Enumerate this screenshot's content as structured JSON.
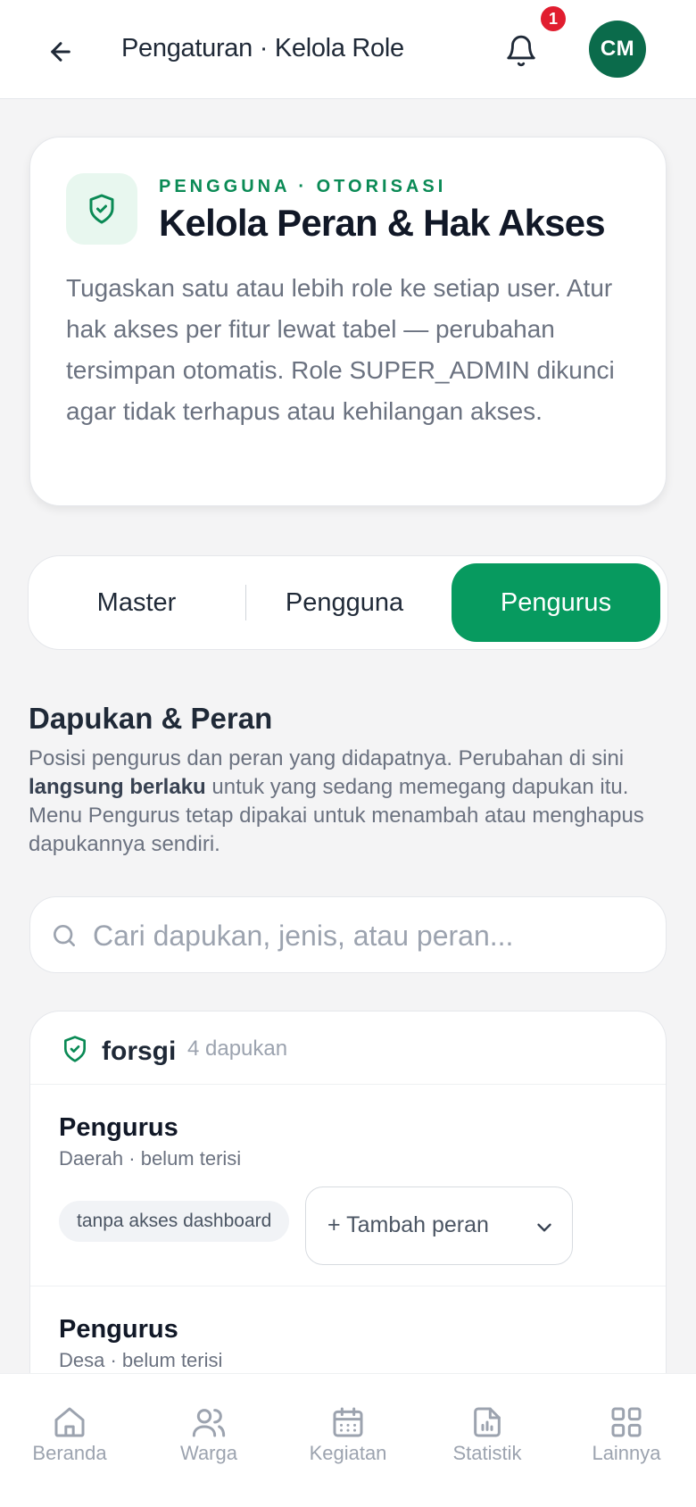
{
  "header": {
    "title": "Pengaturan · Kelola Role",
    "notification_count": "1",
    "avatar_initials": "CM"
  },
  "intro": {
    "eyebrow": "PENGGUNA · OTORISASI",
    "title": "Kelola Peran & Hak Akses",
    "description": "Tugaskan satu atau lebih role ke setiap user. Atur hak akses per fitur lewat tabel — perubahan tersimpan otomatis. Role SUPER_ADMIN dikunci agar tidak terhapus atau kehilangan akses."
  },
  "tabs": [
    {
      "label": "Master",
      "active": false
    },
    {
      "label": "Pengguna",
      "active": false
    },
    {
      "label": "Pengurus",
      "active": true
    }
  ],
  "section": {
    "title": "Dapukan & Peran",
    "desc_part1": "Posisi pengurus dan peran yang didapatnya. Perubahan di sini ",
    "desc_bold": "langsung berlaku",
    "desc_part2": " untuk yang sedang memegang dapukan itu. Menu Pengurus tetap dipakai untuk menambah atau menghapus dapukannya sendiri."
  },
  "search": {
    "placeholder": "Cari dapukan, jenis, atau peran...",
    "value": ""
  },
  "group": {
    "name": "forsgi",
    "count": "4 dapukan",
    "rows": [
      {
        "title": "Pengurus",
        "subtitle": "Daerah · belum terisi",
        "chip": "tanpa akses dashboard",
        "add_label": "+ Tambah peran"
      },
      {
        "title": "Pengurus",
        "subtitle": "Desa · belum terisi"
      }
    ]
  },
  "bottom_nav": [
    {
      "label": "Beranda",
      "icon": "home-icon"
    },
    {
      "label": "Warga",
      "icon": "users-icon"
    },
    {
      "label": "Kegiatan",
      "icon": "calendar-icon"
    },
    {
      "label": "Statistik",
      "icon": "chart-icon"
    },
    {
      "label": "Lainnya",
      "icon": "grid-icon"
    }
  ],
  "colors": {
    "primary": "#079a5f",
    "accent_text": "#0a8a55",
    "avatar": "#0b6b4b",
    "badge": "#e11d2f"
  }
}
